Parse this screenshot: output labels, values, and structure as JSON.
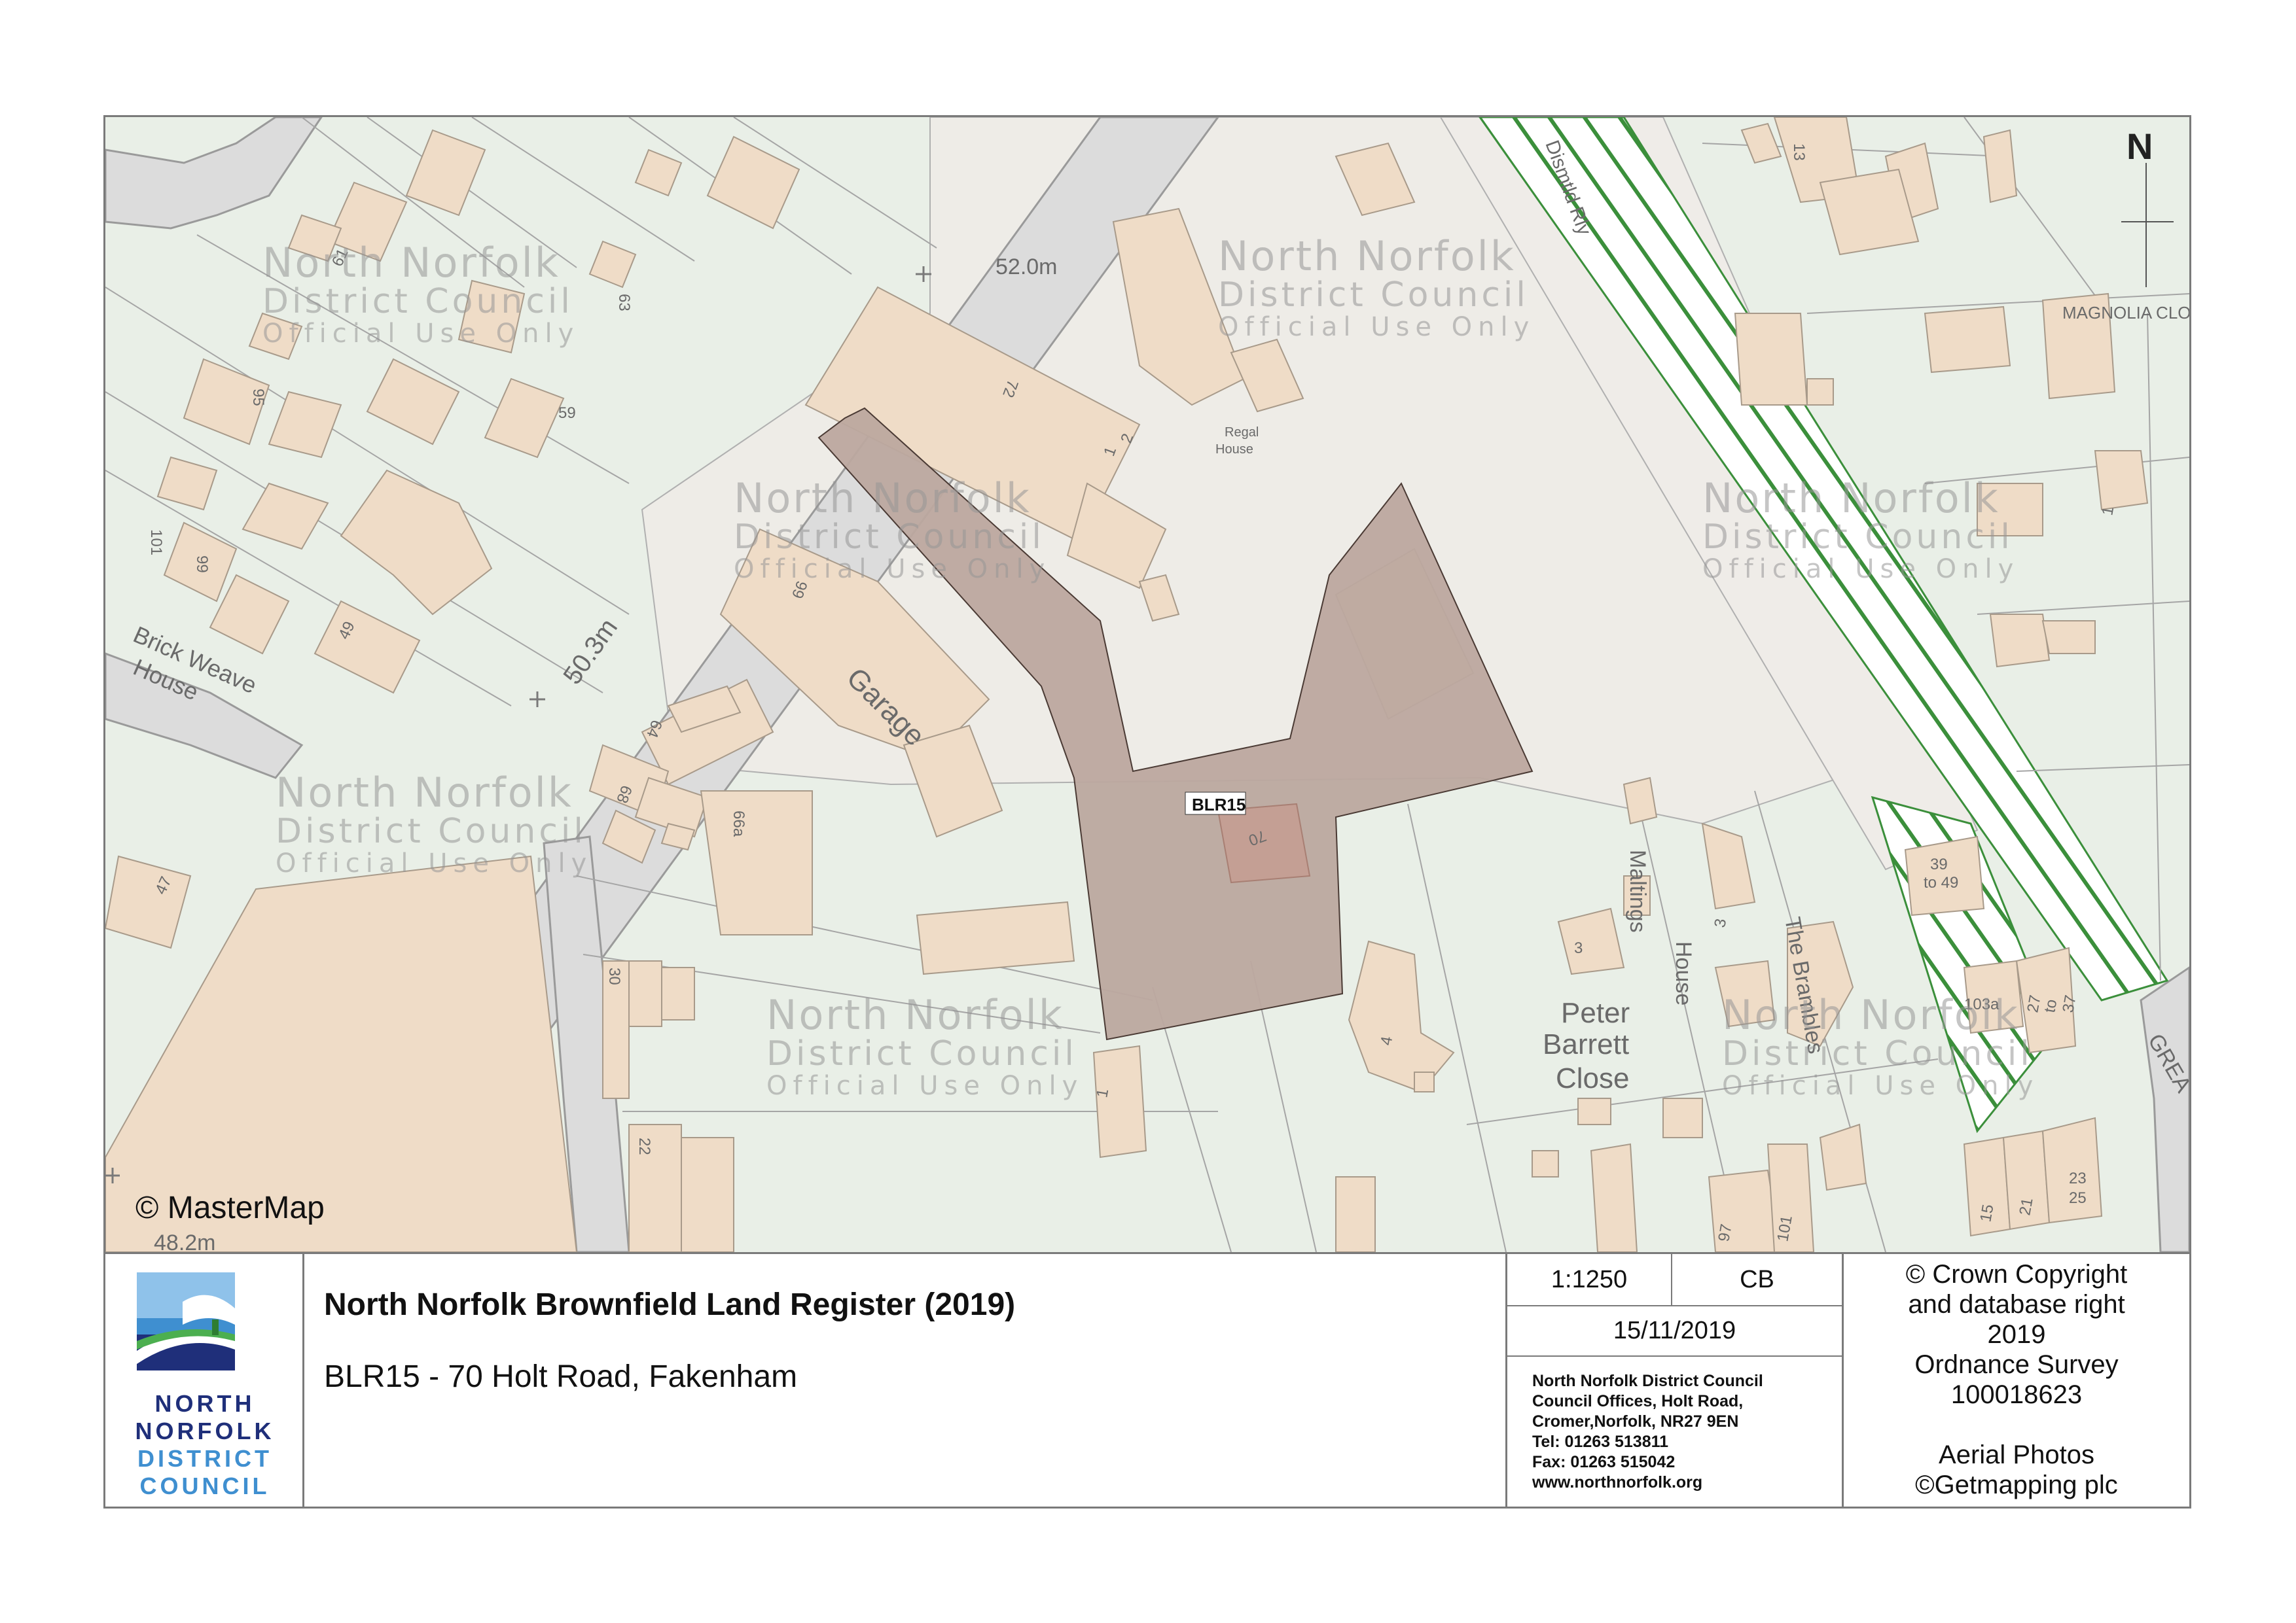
{
  "map": {
    "site_label": "BLR15",
    "north_label": "N",
    "attribution": "© MasterMap",
    "watermark": {
      "line1": "North Norfolk",
      "line2": "District Council",
      "line3": "Official Use Only"
    },
    "labels": {
      "garage": "Garage",
      "brick_weave_1": "Brick Weave",
      "brick_weave_2": "House",
      "regal_1": "Regal",
      "regal_2": "House",
      "maltings_1": "Maltings",
      "maltings_2": "House",
      "brambles": "The Brambles",
      "peter_1": "Peter",
      "peter_2": "Barrett",
      "peter_3": "Close",
      "magnolia": "MAGNOLIA CLO",
      "great": "GREA",
      "dismtld": "Dismtld Rly",
      "spot_52": "52.0m",
      "spot_50": "50.3m",
      "spot_48": "48.2m"
    },
    "numbers": [
      "13",
      "63",
      "95",
      "59",
      "101",
      "99",
      "49",
      "47",
      "72",
      "1",
      "2",
      "66",
      "64",
      "68",
      "66a",
      "70",
      "30",
      "22",
      "3",
      "1",
      "4",
      "3",
      "39",
      "to 49",
      "103a",
      "27",
      "to",
      "37",
      "1",
      "97",
      "101",
      "15",
      "21",
      "23",
      "25",
      "61"
    ]
  },
  "title_block": {
    "title": "North Norfolk Brownfield Land Register (2019)",
    "subtitle": "BLR15 - 70 Holt Road, Fakenham",
    "scale": "1:1250",
    "initials": "CB",
    "date": "15/11/2019",
    "address": [
      "North Norfolk District Council",
      "Council Offices, Holt Road,",
      "Cromer,Norfolk, NR27 9EN",
      "Tel: 01263 513811",
      "Fax: 01263 515042",
      "www.northnorfolk.org"
    ],
    "copyright": [
      "© Crown Copyright",
      "and database right",
      "2019",
      "Ordnance Survey",
      "100018623",
      "",
      "Aerial Photos",
      "©Getmapping plc"
    ],
    "logo": {
      "line1": "NORTH",
      "line2": "NORFOLK",
      "line3": "DISTRICT",
      "line4": "COUNCIL"
    }
  },
  "colors": {
    "site_fill": "#bca89f",
    "building": "#efdcc7",
    "land": "#e9efe7",
    "road": "#dcdcdc",
    "railway_hatch": "#3b8f3b"
  }
}
